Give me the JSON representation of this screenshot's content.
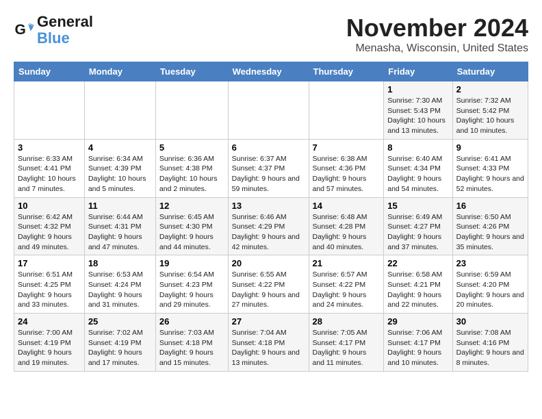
{
  "logo": {
    "text_general": "General",
    "text_blue": "Blue"
  },
  "title": "November 2024",
  "location": "Menasha, Wisconsin, United States",
  "weekdays": [
    "Sunday",
    "Monday",
    "Tuesday",
    "Wednesday",
    "Thursday",
    "Friday",
    "Saturday"
  ],
  "weeks": [
    [
      {
        "day": "",
        "info": ""
      },
      {
        "day": "",
        "info": ""
      },
      {
        "day": "",
        "info": ""
      },
      {
        "day": "",
        "info": ""
      },
      {
        "day": "",
        "info": ""
      },
      {
        "day": "1",
        "info": "Sunrise: 7:30 AM\nSunset: 5:43 PM\nDaylight: 10 hours and 13 minutes."
      },
      {
        "day": "2",
        "info": "Sunrise: 7:32 AM\nSunset: 5:42 PM\nDaylight: 10 hours and 10 minutes."
      }
    ],
    [
      {
        "day": "3",
        "info": "Sunrise: 6:33 AM\nSunset: 4:41 PM\nDaylight: 10 hours and 7 minutes."
      },
      {
        "day": "4",
        "info": "Sunrise: 6:34 AM\nSunset: 4:39 PM\nDaylight: 10 hours and 5 minutes."
      },
      {
        "day": "5",
        "info": "Sunrise: 6:36 AM\nSunset: 4:38 PM\nDaylight: 10 hours and 2 minutes."
      },
      {
        "day": "6",
        "info": "Sunrise: 6:37 AM\nSunset: 4:37 PM\nDaylight: 9 hours and 59 minutes."
      },
      {
        "day": "7",
        "info": "Sunrise: 6:38 AM\nSunset: 4:36 PM\nDaylight: 9 hours and 57 minutes."
      },
      {
        "day": "8",
        "info": "Sunrise: 6:40 AM\nSunset: 4:34 PM\nDaylight: 9 hours and 54 minutes."
      },
      {
        "day": "9",
        "info": "Sunrise: 6:41 AM\nSunset: 4:33 PM\nDaylight: 9 hours and 52 minutes."
      }
    ],
    [
      {
        "day": "10",
        "info": "Sunrise: 6:42 AM\nSunset: 4:32 PM\nDaylight: 9 hours and 49 minutes."
      },
      {
        "day": "11",
        "info": "Sunrise: 6:44 AM\nSunset: 4:31 PM\nDaylight: 9 hours and 47 minutes."
      },
      {
        "day": "12",
        "info": "Sunrise: 6:45 AM\nSunset: 4:30 PM\nDaylight: 9 hours and 44 minutes."
      },
      {
        "day": "13",
        "info": "Sunrise: 6:46 AM\nSunset: 4:29 PM\nDaylight: 9 hours and 42 minutes."
      },
      {
        "day": "14",
        "info": "Sunrise: 6:48 AM\nSunset: 4:28 PM\nDaylight: 9 hours and 40 minutes."
      },
      {
        "day": "15",
        "info": "Sunrise: 6:49 AM\nSunset: 4:27 PM\nDaylight: 9 hours and 37 minutes."
      },
      {
        "day": "16",
        "info": "Sunrise: 6:50 AM\nSunset: 4:26 PM\nDaylight: 9 hours and 35 minutes."
      }
    ],
    [
      {
        "day": "17",
        "info": "Sunrise: 6:51 AM\nSunset: 4:25 PM\nDaylight: 9 hours and 33 minutes."
      },
      {
        "day": "18",
        "info": "Sunrise: 6:53 AM\nSunset: 4:24 PM\nDaylight: 9 hours and 31 minutes."
      },
      {
        "day": "19",
        "info": "Sunrise: 6:54 AM\nSunset: 4:23 PM\nDaylight: 9 hours and 29 minutes."
      },
      {
        "day": "20",
        "info": "Sunrise: 6:55 AM\nSunset: 4:22 PM\nDaylight: 9 hours and 27 minutes."
      },
      {
        "day": "21",
        "info": "Sunrise: 6:57 AM\nSunset: 4:22 PM\nDaylight: 9 hours and 24 minutes."
      },
      {
        "day": "22",
        "info": "Sunrise: 6:58 AM\nSunset: 4:21 PM\nDaylight: 9 hours and 22 minutes."
      },
      {
        "day": "23",
        "info": "Sunrise: 6:59 AM\nSunset: 4:20 PM\nDaylight: 9 hours and 20 minutes."
      }
    ],
    [
      {
        "day": "24",
        "info": "Sunrise: 7:00 AM\nSunset: 4:19 PM\nDaylight: 9 hours and 19 minutes."
      },
      {
        "day": "25",
        "info": "Sunrise: 7:02 AM\nSunset: 4:19 PM\nDaylight: 9 hours and 17 minutes."
      },
      {
        "day": "26",
        "info": "Sunrise: 7:03 AM\nSunset: 4:18 PM\nDaylight: 9 hours and 15 minutes."
      },
      {
        "day": "27",
        "info": "Sunrise: 7:04 AM\nSunset: 4:18 PM\nDaylight: 9 hours and 13 minutes."
      },
      {
        "day": "28",
        "info": "Sunrise: 7:05 AM\nSunset: 4:17 PM\nDaylight: 9 hours and 11 minutes."
      },
      {
        "day": "29",
        "info": "Sunrise: 7:06 AM\nSunset: 4:17 PM\nDaylight: 9 hours and 10 minutes."
      },
      {
        "day": "30",
        "info": "Sunrise: 7:08 AM\nSunset: 4:16 PM\nDaylight: 9 hours and 8 minutes."
      }
    ]
  ]
}
